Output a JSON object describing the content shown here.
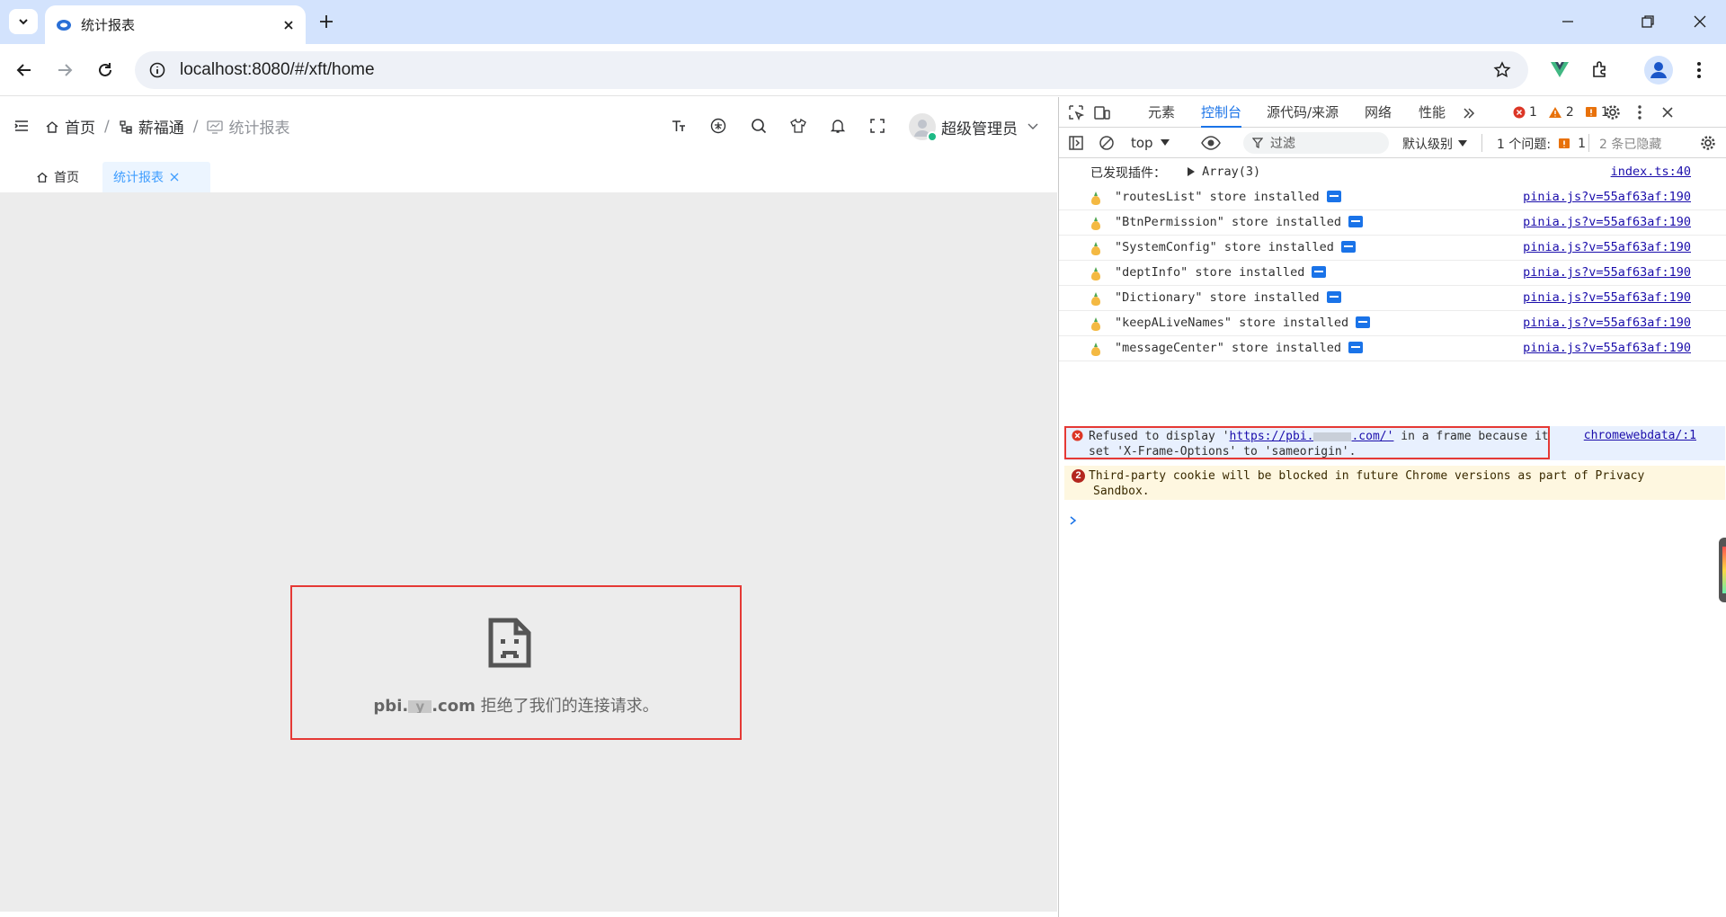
{
  "browser": {
    "tab_title": "统计报表",
    "url": "localhost:8080/#/xft/home"
  },
  "app": {
    "breadcrumb": [
      "首页",
      "薪福通",
      "统计报表"
    ],
    "user_name": "超级管理员",
    "tags": [
      "首页",
      "统计报表"
    ],
    "error_host_prefix": "pbi.",
    "error_host_mask": "y",
    "error_host_suffix": ".com",
    "error_message": "拒绝了我们的连接请求。"
  },
  "devtools": {
    "tabs": [
      "元素",
      "控制台",
      "源代码/来源",
      "网络",
      "性能"
    ],
    "active_tab": "控制台",
    "error_count": "1",
    "warning_count": "2",
    "issue_count": "1",
    "context": "top",
    "filter_placeholder": "过滤",
    "level": "默认级别",
    "issues_label": "1 个问题:",
    "issues_num": "1",
    "hidden": "2 条已隐藏",
    "log_plugin_label": "已发现插件：",
    "log_plugin_value": "Array(3)",
    "log_plugin_src": "index.ts:40",
    "store_logs": [
      {
        "msg": "\"routesList\" store installed",
        "src": "pinia.js?v=55af63af:190"
      },
      {
        "msg": "\"BtnPermission\" store installed",
        "src": "pinia.js?v=55af63af:190"
      },
      {
        "msg": "\"SystemConfig\" store installed",
        "src": "pinia.js?v=55af63af:190"
      },
      {
        "msg": "\"deptInfo\" store installed",
        "src": "pinia.js?v=55af63af:190"
      },
      {
        "msg": "\"Dictionary\" store installed",
        "src": "pinia.js?v=55af63af:190"
      },
      {
        "msg": "\"keepALiveNames\" store installed",
        "src": "pinia.js?v=55af63af:190"
      },
      {
        "msg": "\"messageCenter\" store installed",
        "src": "pinia.js?v=55af63af:190"
      }
    ],
    "error_line1_pre": "Refused to display '",
    "error_link": "https://pbi.",
    "error_link_end": ".com/'",
    "error_line1_post": " in a frame because it",
    "error_line2": "set 'X-Frame-Options' to 'sameorigin'.",
    "error_src": "chromewebdata/:1",
    "warning_badge": "2",
    "warning_line1": "Third-party cookie will be blocked in future Chrome versions as part of Privacy",
    "warning_line2": "Sandbox."
  },
  "colors": {
    "accent": "#409eff",
    "error": "#e53935",
    "warning_bg": "#fef7e0",
    "chrome_frame": "#d3e3fd"
  }
}
